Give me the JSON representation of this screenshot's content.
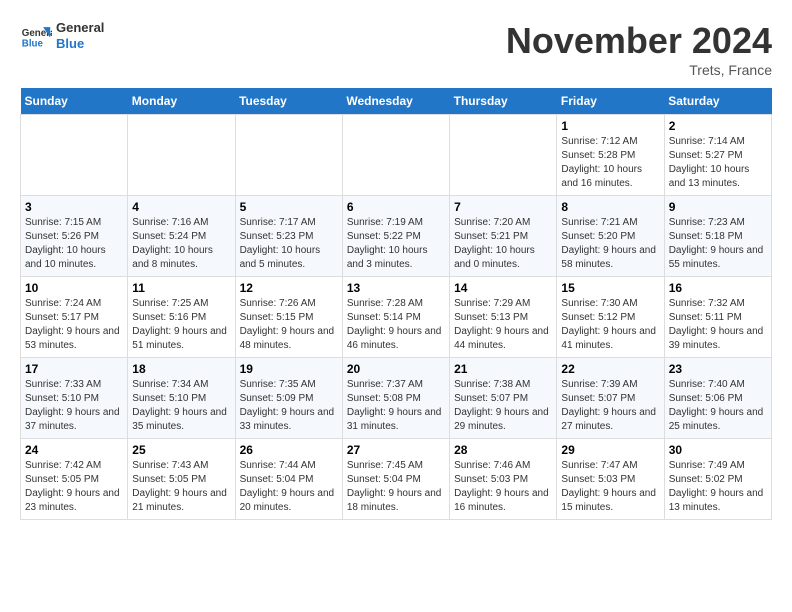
{
  "header": {
    "logo_line1": "General",
    "logo_line2": "Blue",
    "month": "November 2024",
    "location": "Trets, France"
  },
  "weekdays": [
    "Sunday",
    "Monday",
    "Tuesday",
    "Wednesday",
    "Thursday",
    "Friday",
    "Saturday"
  ],
  "weeks": [
    [
      {
        "day": "",
        "info": ""
      },
      {
        "day": "",
        "info": ""
      },
      {
        "day": "",
        "info": ""
      },
      {
        "day": "",
        "info": ""
      },
      {
        "day": "",
        "info": ""
      },
      {
        "day": "1",
        "info": "Sunrise: 7:12 AM\nSunset: 5:28 PM\nDaylight: 10 hours and 16 minutes."
      },
      {
        "day": "2",
        "info": "Sunrise: 7:14 AM\nSunset: 5:27 PM\nDaylight: 10 hours and 13 minutes."
      }
    ],
    [
      {
        "day": "3",
        "info": "Sunrise: 7:15 AM\nSunset: 5:26 PM\nDaylight: 10 hours and 10 minutes."
      },
      {
        "day": "4",
        "info": "Sunrise: 7:16 AM\nSunset: 5:24 PM\nDaylight: 10 hours and 8 minutes."
      },
      {
        "day": "5",
        "info": "Sunrise: 7:17 AM\nSunset: 5:23 PM\nDaylight: 10 hours and 5 minutes."
      },
      {
        "day": "6",
        "info": "Sunrise: 7:19 AM\nSunset: 5:22 PM\nDaylight: 10 hours and 3 minutes."
      },
      {
        "day": "7",
        "info": "Sunrise: 7:20 AM\nSunset: 5:21 PM\nDaylight: 10 hours and 0 minutes."
      },
      {
        "day": "8",
        "info": "Sunrise: 7:21 AM\nSunset: 5:20 PM\nDaylight: 9 hours and 58 minutes."
      },
      {
        "day": "9",
        "info": "Sunrise: 7:23 AM\nSunset: 5:18 PM\nDaylight: 9 hours and 55 minutes."
      }
    ],
    [
      {
        "day": "10",
        "info": "Sunrise: 7:24 AM\nSunset: 5:17 PM\nDaylight: 9 hours and 53 minutes."
      },
      {
        "day": "11",
        "info": "Sunrise: 7:25 AM\nSunset: 5:16 PM\nDaylight: 9 hours and 51 minutes."
      },
      {
        "day": "12",
        "info": "Sunrise: 7:26 AM\nSunset: 5:15 PM\nDaylight: 9 hours and 48 minutes."
      },
      {
        "day": "13",
        "info": "Sunrise: 7:28 AM\nSunset: 5:14 PM\nDaylight: 9 hours and 46 minutes."
      },
      {
        "day": "14",
        "info": "Sunrise: 7:29 AM\nSunset: 5:13 PM\nDaylight: 9 hours and 44 minutes."
      },
      {
        "day": "15",
        "info": "Sunrise: 7:30 AM\nSunset: 5:12 PM\nDaylight: 9 hours and 41 minutes."
      },
      {
        "day": "16",
        "info": "Sunrise: 7:32 AM\nSunset: 5:11 PM\nDaylight: 9 hours and 39 minutes."
      }
    ],
    [
      {
        "day": "17",
        "info": "Sunrise: 7:33 AM\nSunset: 5:10 PM\nDaylight: 9 hours and 37 minutes."
      },
      {
        "day": "18",
        "info": "Sunrise: 7:34 AM\nSunset: 5:10 PM\nDaylight: 9 hours and 35 minutes."
      },
      {
        "day": "19",
        "info": "Sunrise: 7:35 AM\nSunset: 5:09 PM\nDaylight: 9 hours and 33 minutes."
      },
      {
        "day": "20",
        "info": "Sunrise: 7:37 AM\nSunset: 5:08 PM\nDaylight: 9 hours and 31 minutes."
      },
      {
        "day": "21",
        "info": "Sunrise: 7:38 AM\nSunset: 5:07 PM\nDaylight: 9 hours and 29 minutes."
      },
      {
        "day": "22",
        "info": "Sunrise: 7:39 AM\nSunset: 5:07 PM\nDaylight: 9 hours and 27 minutes."
      },
      {
        "day": "23",
        "info": "Sunrise: 7:40 AM\nSunset: 5:06 PM\nDaylight: 9 hours and 25 minutes."
      }
    ],
    [
      {
        "day": "24",
        "info": "Sunrise: 7:42 AM\nSunset: 5:05 PM\nDaylight: 9 hours and 23 minutes."
      },
      {
        "day": "25",
        "info": "Sunrise: 7:43 AM\nSunset: 5:05 PM\nDaylight: 9 hours and 21 minutes."
      },
      {
        "day": "26",
        "info": "Sunrise: 7:44 AM\nSunset: 5:04 PM\nDaylight: 9 hours and 20 minutes."
      },
      {
        "day": "27",
        "info": "Sunrise: 7:45 AM\nSunset: 5:04 PM\nDaylight: 9 hours and 18 minutes."
      },
      {
        "day": "28",
        "info": "Sunrise: 7:46 AM\nSunset: 5:03 PM\nDaylight: 9 hours and 16 minutes."
      },
      {
        "day": "29",
        "info": "Sunrise: 7:47 AM\nSunset: 5:03 PM\nDaylight: 9 hours and 15 minutes."
      },
      {
        "day": "30",
        "info": "Sunrise: 7:49 AM\nSunset: 5:02 PM\nDaylight: 9 hours and 13 minutes."
      }
    ]
  ]
}
